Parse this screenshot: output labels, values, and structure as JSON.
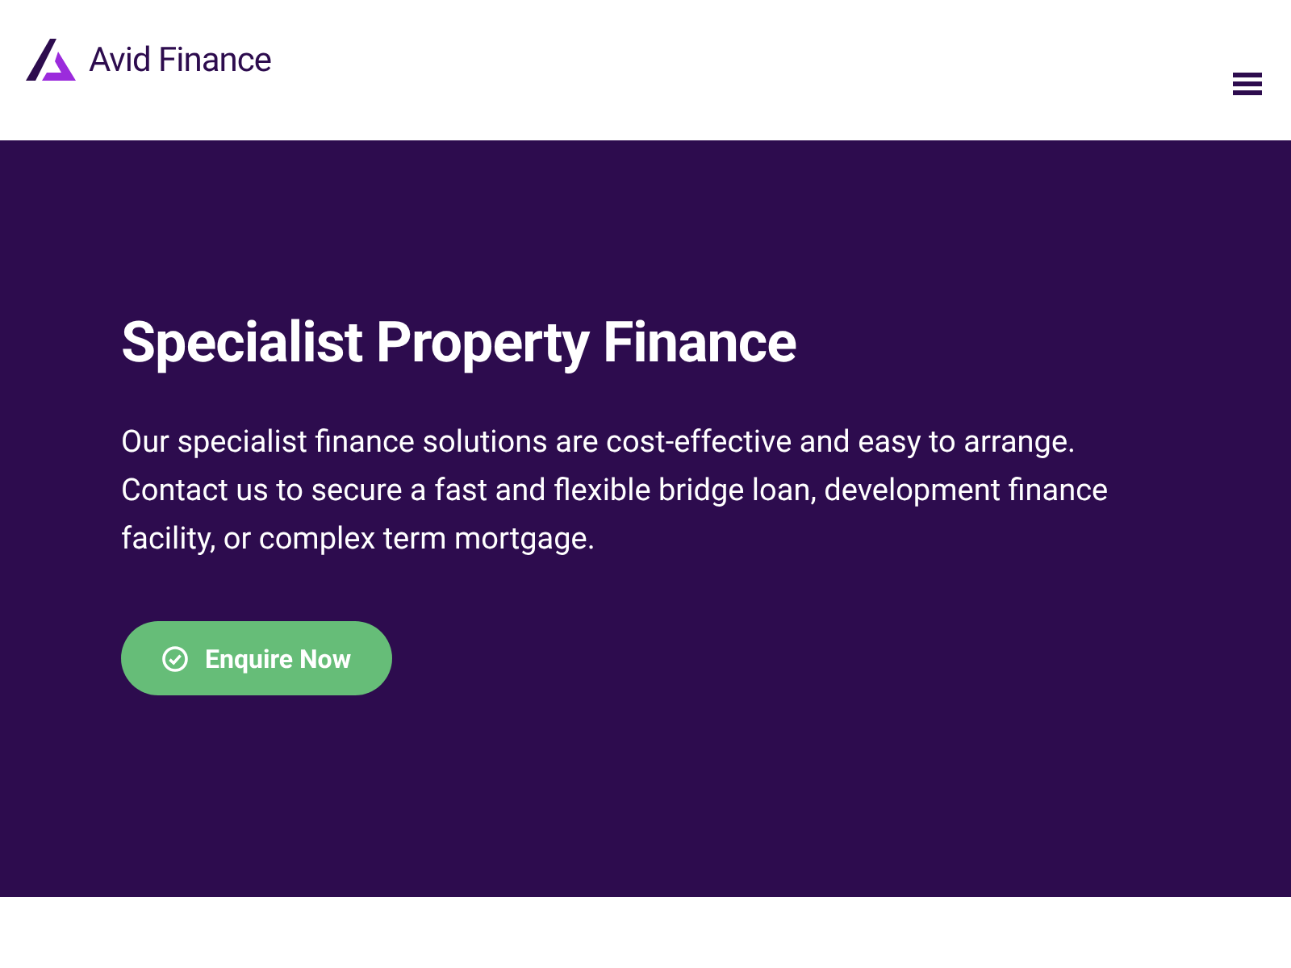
{
  "header": {
    "logo_text": "Avid Finance"
  },
  "hero": {
    "title": "Specialist Property Finance",
    "text": "Our specialist finance solutions are cost-effective and easy to arrange. Contact us to secure a fast and flexible bridge loan, development finance facility, or complex term mortgage.",
    "button": "Enquire Now"
  }
}
